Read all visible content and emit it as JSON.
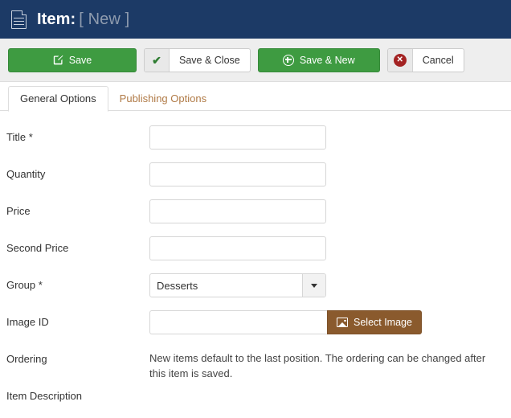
{
  "header": {
    "icon": "document-icon",
    "title": "Item:",
    "state_badge": "[ New ]",
    "background_color": "#1c3a66"
  },
  "toolbar": {
    "buttons": [
      {
        "label": "Save",
        "icon": "pencil-square-icon",
        "style": "green",
        "color": "#3e9b41"
      },
      {
        "label": "Save & Close",
        "icon": "check-icon",
        "style": "split-white",
        "color": "#2f7d32"
      },
      {
        "label": "Save & New",
        "icon": "plus-circle-icon",
        "style": "green",
        "color": "#3e9b41"
      },
      {
        "label": "Cancel",
        "icon": "x-circle-icon",
        "style": "split-white",
        "color": "#a32222"
      }
    ]
  },
  "tabs": [
    {
      "label": "General Options",
      "active": true
    },
    {
      "label": "Publishing Options",
      "active": false
    }
  ],
  "form": {
    "fields": [
      {
        "label": "Title *",
        "type": "text",
        "value": "",
        "placeholder": ""
      },
      {
        "label": "Quantity",
        "type": "text",
        "value": "",
        "placeholder": ""
      },
      {
        "label": "Price",
        "type": "text",
        "value": "",
        "placeholder": ""
      },
      {
        "label": "Second Price",
        "type": "text",
        "value": "",
        "placeholder": ""
      },
      {
        "label": "Group *",
        "type": "select",
        "value": "Desserts",
        "placeholder": ""
      },
      {
        "label": "Image ID",
        "type": "text-with-button",
        "value": "",
        "placeholder": "",
        "button_label": "Select Image",
        "button_color": "#8a5a2d"
      },
      {
        "label": "Ordering",
        "type": "help",
        "help": "New items default to the last position. The ordering can be changed after this item is saved."
      },
      {
        "label": "Item Description",
        "type": "label-only"
      }
    ]
  }
}
